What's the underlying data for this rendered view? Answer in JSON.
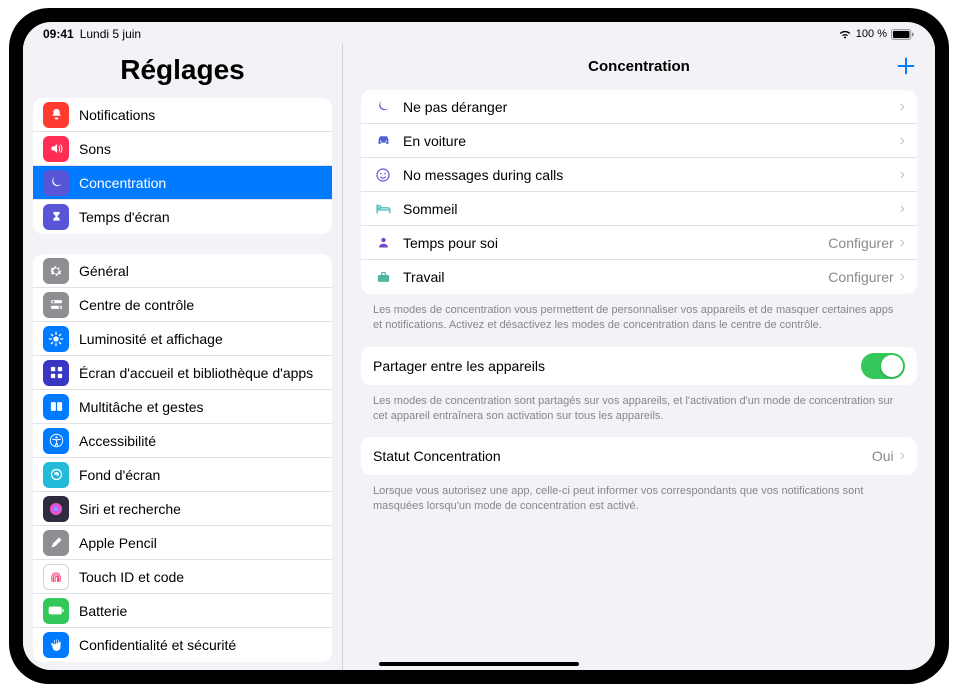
{
  "status": {
    "time": "09:41",
    "date": "Lundi 5 juin",
    "battery_text": "100 %"
  },
  "sidebar": {
    "title": "Réglages",
    "group1": [
      {
        "label": "Notifications",
        "icon_bg": "#ff3b30",
        "icon": "bell"
      },
      {
        "label": "Sons",
        "icon_bg": "#ff2d55",
        "icon": "speaker"
      },
      {
        "label": "Concentration",
        "icon_bg": "#5856d6",
        "icon": "moon",
        "selected": true
      },
      {
        "label": "Temps d'écran",
        "icon_bg": "#5856d6",
        "icon": "hourglass"
      }
    ],
    "group2": [
      {
        "label": "Général",
        "icon_bg": "#8e8e93",
        "icon": "gear"
      },
      {
        "label": "Centre de contrôle",
        "icon_bg": "#8e8e93",
        "icon": "switches"
      },
      {
        "label": "Luminosité et affichage",
        "icon_bg": "#007aff",
        "icon": "brightness"
      },
      {
        "label": "Écran d'accueil et bibliothèque d'apps",
        "icon_bg": "#3a36c4",
        "icon": "grid"
      },
      {
        "label": "Multitâche et gestes",
        "icon_bg": "#007aff",
        "icon": "multitask"
      },
      {
        "label": "Accessibilité",
        "icon_bg": "#007aff",
        "icon": "accessibility"
      },
      {
        "label": "Fond d'écran",
        "icon_bg": "#23b9d9",
        "icon": "wallpaper"
      },
      {
        "label": "Siri et recherche",
        "icon_bg": "#2e2d3f",
        "icon": "siri"
      },
      {
        "label": "Apple Pencil",
        "icon_bg": "#8e8e93",
        "icon": "pencil"
      },
      {
        "label": "Touch ID et code",
        "icon_bg": "#ffffff",
        "icon": "touchid",
        "icon_border": true
      },
      {
        "label": "Batterie",
        "icon_bg": "#34c759",
        "icon": "battery"
      },
      {
        "label": "Confidentialité et sécurité",
        "icon_bg": "#007aff",
        "icon": "hand"
      }
    ]
  },
  "main": {
    "title": "Concentration",
    "focus_modes": [
      {
        "label": "Ne pas déranger",
        "icon_color": "#5856d6",
        "icon": "moon",
        "value": ""
      },
      {
        "label": "En voiture",
        "icon_color": "#4d61db",
        "icon": "car",
        "value": ""
      },
      {
        "label": "No messages during calls",
        "icon_color": "#5856d6",
        "icon": "face",
        "value": ""
      },
      {
        "label": "Sommeil",
        "icon_color": "#50c4bb",
        "icon": "bed",
        "value": ""
      },
      {
        "label": "Temps pour soi",
        "icon_color": "#6f49c8",
        "icon": "person",
        "value": "Configurer"
      },
      {
        "label": "Travail",
        "icon_color": "#4fb6a5",
        "icon": "briefcase",
        "value": "Configurer"
      }
    ],
    "footer1": "Les modes de concentration vous permettent de personnaliser vos appareils et de masquer certaines apps et notifications. Activez et désactivez les modes de concentration dans le centre de contrôle.",
    "share": {
      "label": "Partager entre les appareils",
      "on": true
    },
    "footer2": "Les modes de concentration sont partagés sur vos appareils, et l'activation d'un mode de concentration sur cet appareil entraînera son activation sur tous les appareils.",
    "status": {
      "label": "Statut Concentration",
      "value": "Oui"
    },
    "footer3": "Lorsque vous autorisez une app, celle-ci peut informer vos correspondants que vos notifications sont masquées lorsqu'un mode de concentration est activé."
  }
}
